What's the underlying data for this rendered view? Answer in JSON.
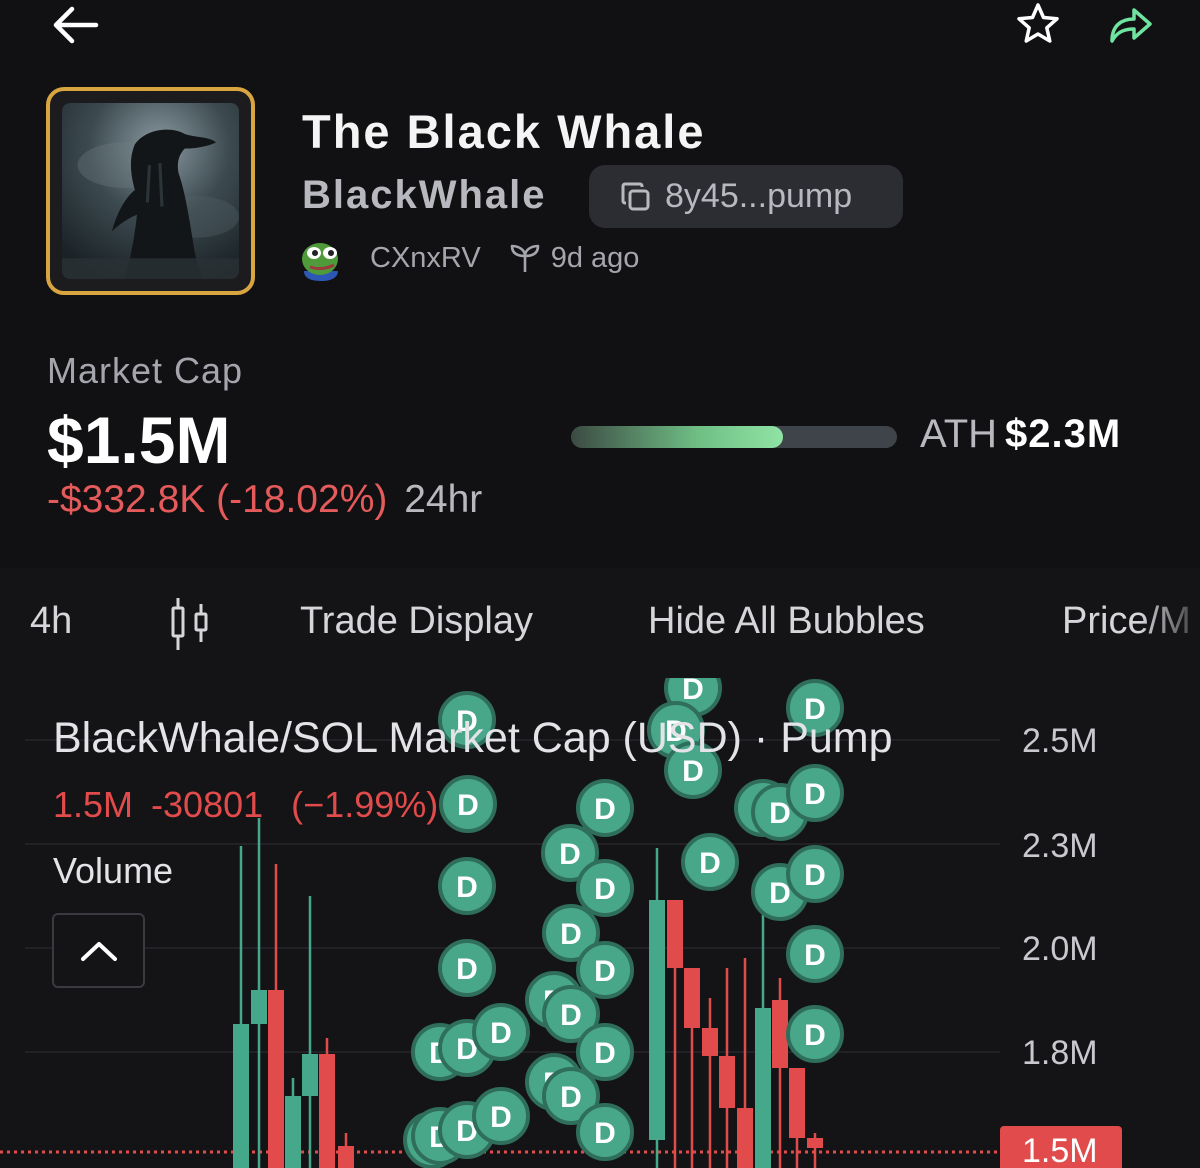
{
  "header": {
    "back_icon": "arrow-left-icon",
    "favorite_icon": "star-outline-icon",
    "share_icon": "share-arrow-icon",
    "accent_color": "#6fe3a0"
  },
  "token": {
    "name": "The Black Whale",
    "symbol": "BlackWhale",
    "address": "8y45...pump",
    "creator": "CXnxRV",
    "age": "9d ago",
    "image_border_color": "#d9a540"
  },
  "market_cap": {
    "label": "Market Cap",
    "value": "$1.5M",
    "change": "-$332.8K (-18.02%)",
    "period": "24hr",
    "ath_label": "ATH",
    "ath_value": "$2.3M",
    "ath_progress": 0.65
  },
  "chart_toolbar": {
    "interval": "4h",
    "candle_icon": "candlestick-icon",
    "trade_display": "Trade Display",
    "hide_bubbles": "Hide All Bubbles",
    "price_toggle": "Price/M"
  },
  "chart_data": {
    "type": "candlestick",
    "title": "BlackWhale/SOL Market Cap (USD) · Pump",
    "last_value": "1.5M",
    "change_abs": "-30801",
    "change_pct": "(−1.99%)",
    "volume_label": "Volume",
    "y_ticks": [
      "2.5M",
      "2.3M",
      "2.0M",
      "1.8M",
      "1.5M"
    ],
    "current_price_label": "1.5M",
    "bubble_label": "D",
    "up_color": "#45a88a",
    "down_color": "#e24b4b"
  }
}
